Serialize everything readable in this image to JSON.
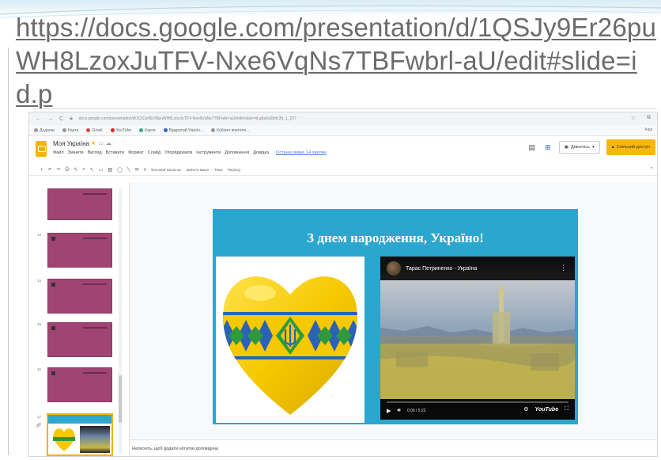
{
  "outer": {
    "url_text": "https://docs.google.com/presentation/d/1QSJy9Er26puWH8LzoxJuTFV-Nxe6VqNs7TBFwbrl-aU/edit#slide=id.p"
  },
  "browser": {
    "address": "docs.google.com/presentation/d/1QSJy9Er26puWH8LzoxJuTFV-Nxe6VqNs7TBFwbrl-aU/edit#slide=id.g6a0a2bdc2b_1_227",
    "bookmarks": [
      "Додатки",
      "Карти",
      "Gmail",
      "YouTube",
      "Карти",
      "Відкритий Україн...",
      "Кабінет вчителя..."
    ],
    "bookmarks_right": "Інші"
  },
  "app": {
    "doc_title": "Моя Україна",
    "menu": [
      "Файл",
      "Змінити",
      "Вигляд",
      "Вставити",
      "Формат",
      "Слайд",
      "Упорядкувати",
      "Інструменти",
      "Доповнення",
      "Довідка"
    ],
    "last_edit": "Останні зміни: 14 хвилин",
    "present_label": "Дивитись",
    "share_label": "Спільний доступ",
    "toolbar_labels": [
      "Фоновий малюнок",
      "Змінити макет",
      "Тема",
      "Перехід"
    ]
  },
  "filmstrip": {
    "slides": [
      {
        "num": ""
      },
      {
        "num": "13"
      },
      {
        "num": "14"
      },
      {
        "num": "15"
      },
      {
        "num": "16"
      },
      {
        "num": "17"
      }
    ]
  },
  "slide": {
    "title": "З днем народження, Україно!",
    "video": {
      "title": "Тарас Петриненко - Україна",
      "time": "0:00 / 5:22",
      "progress": 0.0,
      "logo": "YouTube"
    }
  },
  "notes": {
    "placeholder": "Натисніть, щоб додати нотатки доповідача"
  },
  "colors": {
    "slide_background": "#2aa6cf",
    "thumbnail": "#a04474",
    "heart_yellow": "#f5c800",
    "ornament_blue": "#2a62b8",
    "ornament_green": "#2f9a3d",
    "share_button": "#f9b70e"
  }
}
